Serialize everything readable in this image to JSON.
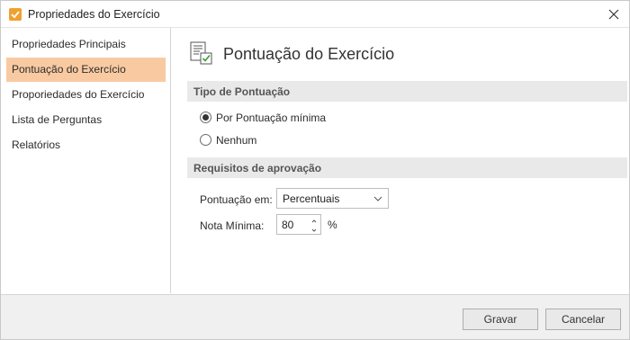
{
  "window": {
    "title": "Propriedades do Exercício",
    "title_icon": "orange-check-icon",
    "close_icon": "close-icon"
  },
  "sidebar": {
    "items": [
      {
        "label": "Propriedades Principais",
        "active": false
      },
      {
        "label": "Pontuação do Exercício",
        "active": true
      },
      {
        "label": "Proporiedades do Exercício",
        "active": false
      },
      {
        "label": "Lista de Perguntas",
        "active": false
      },
      {
        "label": "Relatórios",
        "active": false
      }
    ]
  },
  "main": {
    "page_icon": "score-sheet-icon",
    "page_title": "Pontuação do Exercício",
    "scoring_section": {
      "title": "Tipo de Pontuação",
      "options": [
        {
          "label": "Por Pontuação mínima",
          "checked": true
        },
        {
          "label": "Nenhum",
          "checked": false
        }
      ]
    },
    "approval_section": {
      "title": "Requisitos de aprovação",
      "score_in_label": "Pontuação em:",
      "score_in_value": "Percentuais",
      "min_grade_label": "Nota Mínima:",
      "min_grade_value": "80",
      "min_grade_unit": "%"
    }
  },
  "footer": {
    "save_label": "Gravar",
    "cancel_label": "Cancelar"
  },
  "colors": {
    "accent": "#f0a030",
    "active_item": "#f9caa2",
    "section_bar": "#e9e9e9"
  }
}
